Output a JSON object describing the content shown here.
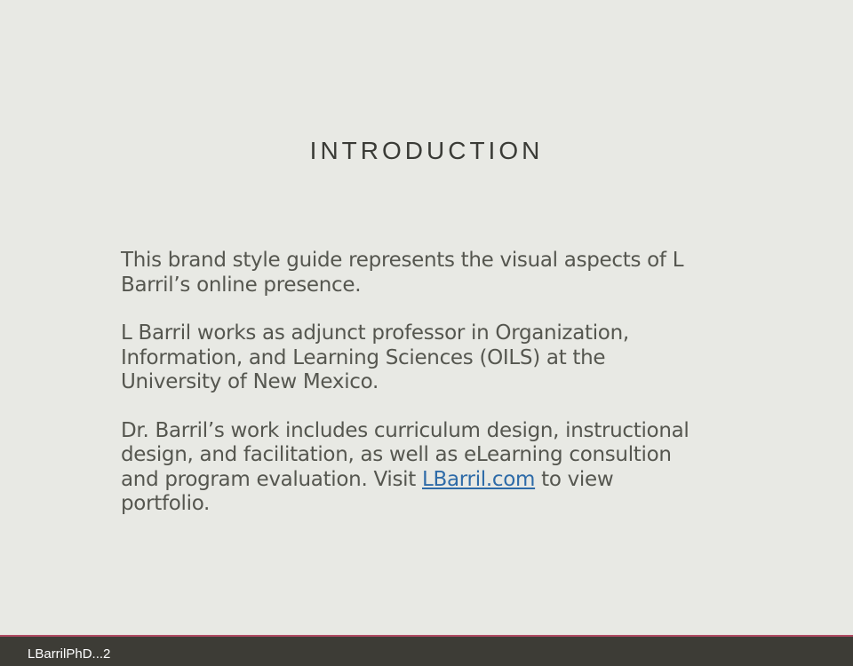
{
  "slide": {
    "title": "INTRODUCTION",
    "paragraph1": "This brand style guide represents the visual aspects of L Barril’s online presence.",
    "paragraph2": "L Barril works as adjunct professor in Organization, Information, and Learning Sciences (OILS) at the University of New Mexico.",
    "paragraph3_before": "Dr. Barril’s work includes curriculum design, instructional design, and facilitation, as well as eLearning consultion and program evaluation. Visit ",
    "paragraph3_link": "LBarril.com",
    "paragraph3_after": " to view portfolio."
  },
  "footer": {
    "label": "LBarrilPhD...2"
  },
  "colors": {
    "background": "#e8e9e4",
    "title": "#3a3b36",
    "body_text": "#55564f",
    "link": "#2e6ba8",
    "footer_bar": "#3d3c36",
    "footer_accent": "#b04a62"
  }
}
